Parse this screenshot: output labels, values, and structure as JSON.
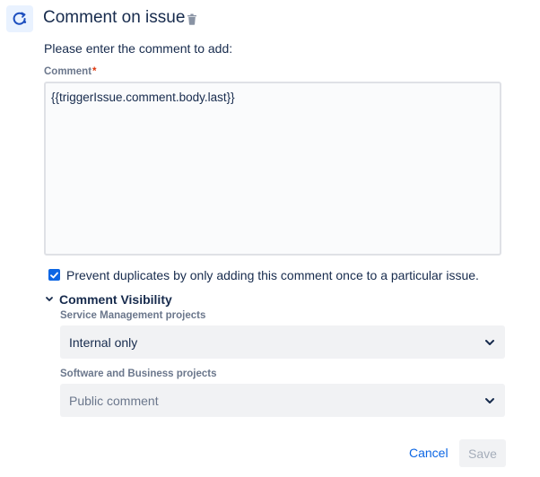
{
  "header": {
    "title": "Comment on issue",
    "action_icon": "comment-action-icon",
    "delete_icon": "trash-icon"
  },
  "form": {
    "instruction": "Please enter the comment to add:",
    "comment_label": "Comment",
    "required_marker": "*",
    "comment_value": "{{triggerIssue.comment.body.last}}",
    "prevent_duplicates": {
      "checked": true,
      "label": "Prevent duplicates by only adding this comment once to a particular issue."
    }
  },
  "visibility": {
    "title": "Comment Visibility",
    "expanded": true,
    "service_management": {
      "label": "Service Management projects",
      "selected": "Internal only"
    },
    "software_business": {
      "label": "Software and Business projects",
      "selected": "Public comment"
    }
  },
  "footer": {
    "cancel_label": "Cancel",
    "save_label": "Save"
  },
  "colors": {
    "accent": "#0c66e4",
    "required": "#de350b",
    "text": "#172b4d",
    "subtle_text": "#6b778c"
  }
}
